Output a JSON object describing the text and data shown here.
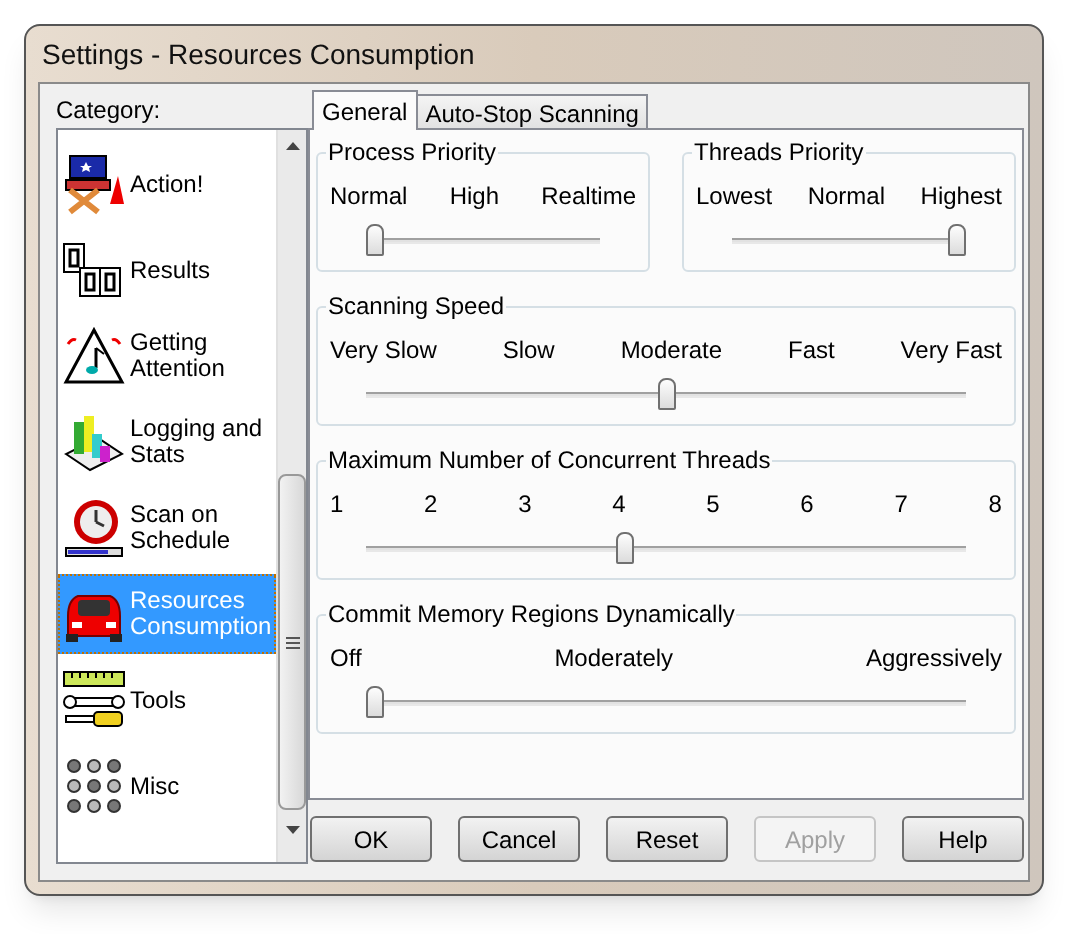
{
  "window": {
    "title": "Settings - Resources Consumption"
  },
  "category_label": "Category:",
  "categories": [
    {
      "label": "Action!",
      "selected": false
    },
    {
      "label": "Results",
      "selected": false
    },
    {
      "label": "Getting Attention",
      "selected": false
    },
    {
      "label": "Logging and Stats",
      "selected": false
    },
    {
      "label": "Scan on Schedule",
      "selected": false
    },
    {
      "label": "Resources Consumption",
      "selected": true
    },
    {
      "label": "Tools",
      "selected": false
    },
    {
      "label": "Misc",
      "selected": false
    }
  ],
  "tabs": [
    {
      "label": "General",
      "selected": true
    },
    {
      "label": "Auto-Stop Scanning",
      "selected": false
    }
  ],
  "groups": [
    {
      "title": "Process Priority",
      "ticks": [
        "Normal",
        "High",
        "Realtime"
      ],
      "level": 0
    },
    {
      "title": "Threads Priority",
      "ticks": [
        "Lowest",
        "Normal",
        "Highest"
      ],
      "level": 1
    },
    {
      "title": "Scanning Speed",
      "ticks": [
        "Very Slow",
        "Slow",
        "Moderate",
        "Fast",
        "Very Fast"
      ],
      "level": 0.5
    },
    {
      "title": "Maximum Number of Concurrent Threads",
      "ticks": [
        "1",
        "2",
        "3",
        "4",
        "5",
        "6",
        "7",
        "8"
      ],
      "level": 0.4286
    },
    {
      "title": "Commit Memory Regions Dynamically",
      "ticks": [
        "Off",
        "Moderately",
        "Aggressively"
      ],
      "level": 0
    }
  ],
  "buttons": [
    {
      "label": "OK",
      "disabled": false
    },
    {
      "label": "Cancel",
      "disabled": false
    },
    {
      "label": "Reset",
      "disabled": false
    },
    {
      "label": "Apply",
      "disabled": true
    },
    {
      "label": "Help",
      "disabled": false
    }
  ]
}
